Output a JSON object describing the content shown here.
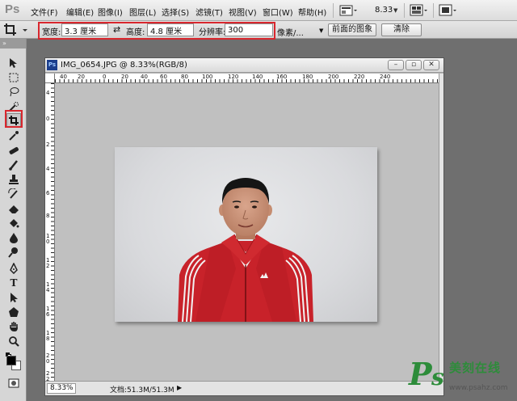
{
  "app": {
    "logo": "Ps"
  },
  "menu": {
    "items": [
      "文件(F)",
      "编辑(E)",
      "图像(I)",
      "图层(L)",
      "选择(S)",
      "滤镜(T)",
      "视图(V)",
      "窗口(W)",
      "帮助(H)"
    ],
    "zoom": "8.33"
  },
  "options": {
    "width_label": "宽度:",
    "width_value": "3.3 厘米",
    "swap_glyph": "⇄",
    "height_label": "高度:",
    "height_value": "4.8 厘米",
    "resolution_label": "分辨率:",
    "resolution_value": "300",
    "unit_select": "像素/...",
    "front_image_button": "前面的图象",
    "clear_button": "清除"
  },
  "document": {
    "title": "IMG_0654.JPG @ 8.33%(RGB/8)",
    "icon_text": "Ps",
    "ruler_top_labels": [
      "40",
      "20",
      "0",
      "20",
      "40",
      "60",
      "80",
      "100",
      "120",
      "140",
      "160",
      "180",
      "200",
      "220",
      "240"
    ],
    "ruler_left_labels": [
      "4",
      "0",
      "2",
      "4",
      "6",
      "8",
      "1\n0",
      "1\n2",
      "1\n4",
      "1\n6",
      "1\n8",
      "2\n0",
      "2\n2"
    ],
    "status_zoom": "8.33%",
    "status_doc": "文档:51.3M/51.3M"
  },
  "watermark": {
    "brand_big": "P",
    "brand_s": "s",
    "brand_cn": "美刻在线",
    "url": "www.psahz.com"
  },
  "colors": {
    "highlight": "#d9272e",
    "jacket_red": "#c8222a",
    "watermark_green": "#2d8c3a"
  }
}
